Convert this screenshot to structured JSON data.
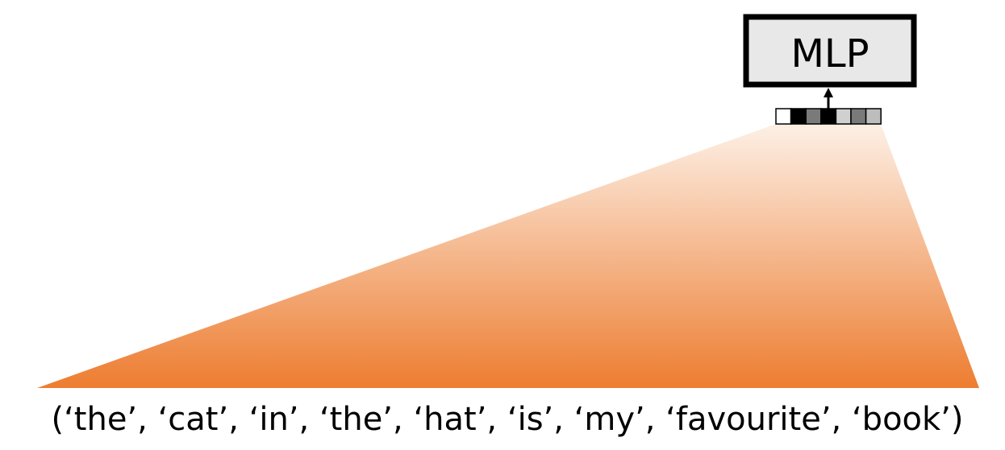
{
  "mlp": {
    "label": "MLP"
  },
  "embedding": {
    "cells": [
      "#ffffff",
      "#000000",
      "#7a7a7a",
      "#000000",
      "#d0d0d0",
      "#7a7a7a",
      "#bdbdbd"
    ]
  },
  "tokens": {
    "text": "(‘the’, ‘cat’, ‘in’, ‘the’, ‘hat’, ‘is’, ‘my’, ‘favourite’, ‘book’)"
  },
  "colors": {
    "fan_bottom": "#ed7d31",
    "fan_top": "#fdf0e6",
    "mlp_fill": "#e8e8e8",
    "mlp_border": "#000000"
  }
}
